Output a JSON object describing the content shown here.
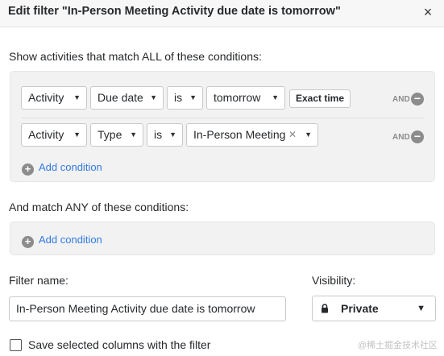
{
  "dialog": {
    "title": "Edit filter \"In-Person Meeting Activity due date is tomorrow\"",
    "close_icon": "×"
  },
  "all_conditions": {
    "heading": "Show activities that match ALL of these conditions:",
    "rows": [
      {
        "entity": "Activity",
        "field": "Due date",
        "operator": "is",
        "value": "tomorrow",
        "extra_button": "Exact time",
        "connector": "AND"
      },
      {
        "entity": "Activity",
        "field": "Type",
        "operator": "is",
        "value": "In-Person Meeting",
        "connector": "AND"
      }
    ],
    "add_label": "Add condition"
  },
  "any_conditions": {
    "heading": "And match ANY of these conditions:",
    "add_label": "Add condition"
  },
  "filter_name": {
    "label": "Filter name:",
    "value": "In-Person Meeting Activity due date is tomorrow"
  },
  "visibility": {
    "label": "Visibility:",
    "value": "Private",
    "icon": "lock-icon"
  },
  "save_columns": {
    "label": "Save selected columns with the filter",
    "checked": false
  },
  "watermark": "@稀土掘金技术社区"
}
